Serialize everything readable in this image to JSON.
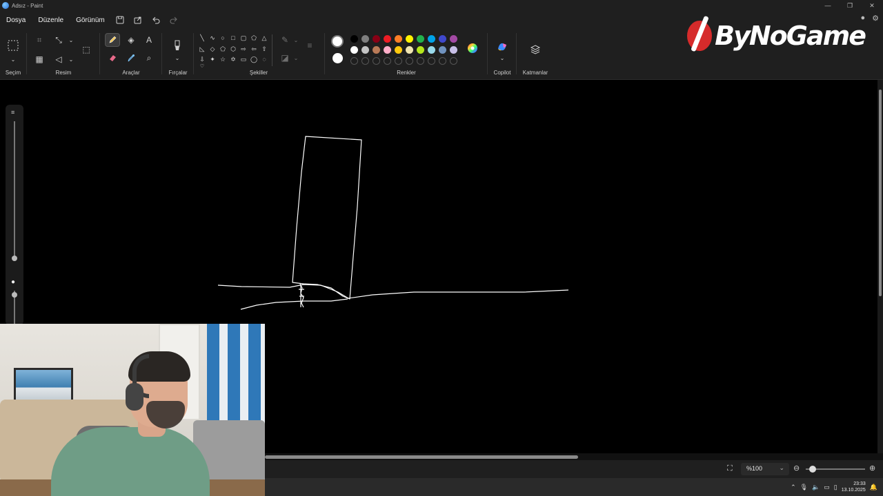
{
  "window": {
    "title": "Adsız - Paint",
    "controls": [
      "minimize-icon",
      "restore-icon",
      "close-icon"
    ]
  },
  "menu": {
    "items": [
      "Dosya",
      "Düzenle",
      "Görünüm"
    ],
    "icons": [
      "save-icon",
      "share-icon",
      "undo-icon",
      "redo-icon"
    ],
    "right_icons": [
      "account-icon",
      "settings-icon"
    ]
  },
  "ribbon": {
    "groups": {
      "selection": "Seçim",
      "image": "Resim",
      "tools": "Araçlar",
      "brushes": "Fırçalar",
      "shapes": "Şekiller",
      "colors": "Renkler",
      "copilot": "Copilot",
      "layers": "Katmanlar"
    },
    "text_tool_glyph": "A",
    "palette_row1": [
      "#000000",
      "#7f7f7f",
      "#880015",
      "#ed1c24",
      "#ff7f27",
      "#fff200",
      "#22b14c",
      "#00a2e8",
      "#3f48cc",
      "#a349a4"
    ],
    "palette_row2": [
      "#ffffff",
      "#c3c3c3",
      "#b97a57",
      "#ffaec9",
      "#ffc90e",
      "#efe4b0",
      "#b5e61d",
      "#99d9ea",
      "#7092be",
      "#c8bfe7"
    ],
    "primary_color": "#ffffff",
    "secondary_color": "#ffffff"
  },
  "logo": {
    "text": "ByNoGame"
  },
  "status": {
    "zoom": "%100",
    "zoom_level_fraction": 0.12
  },
  "taskbar": {
    "time": "23:33",
    "date": "13.10.2025"
  }
}
